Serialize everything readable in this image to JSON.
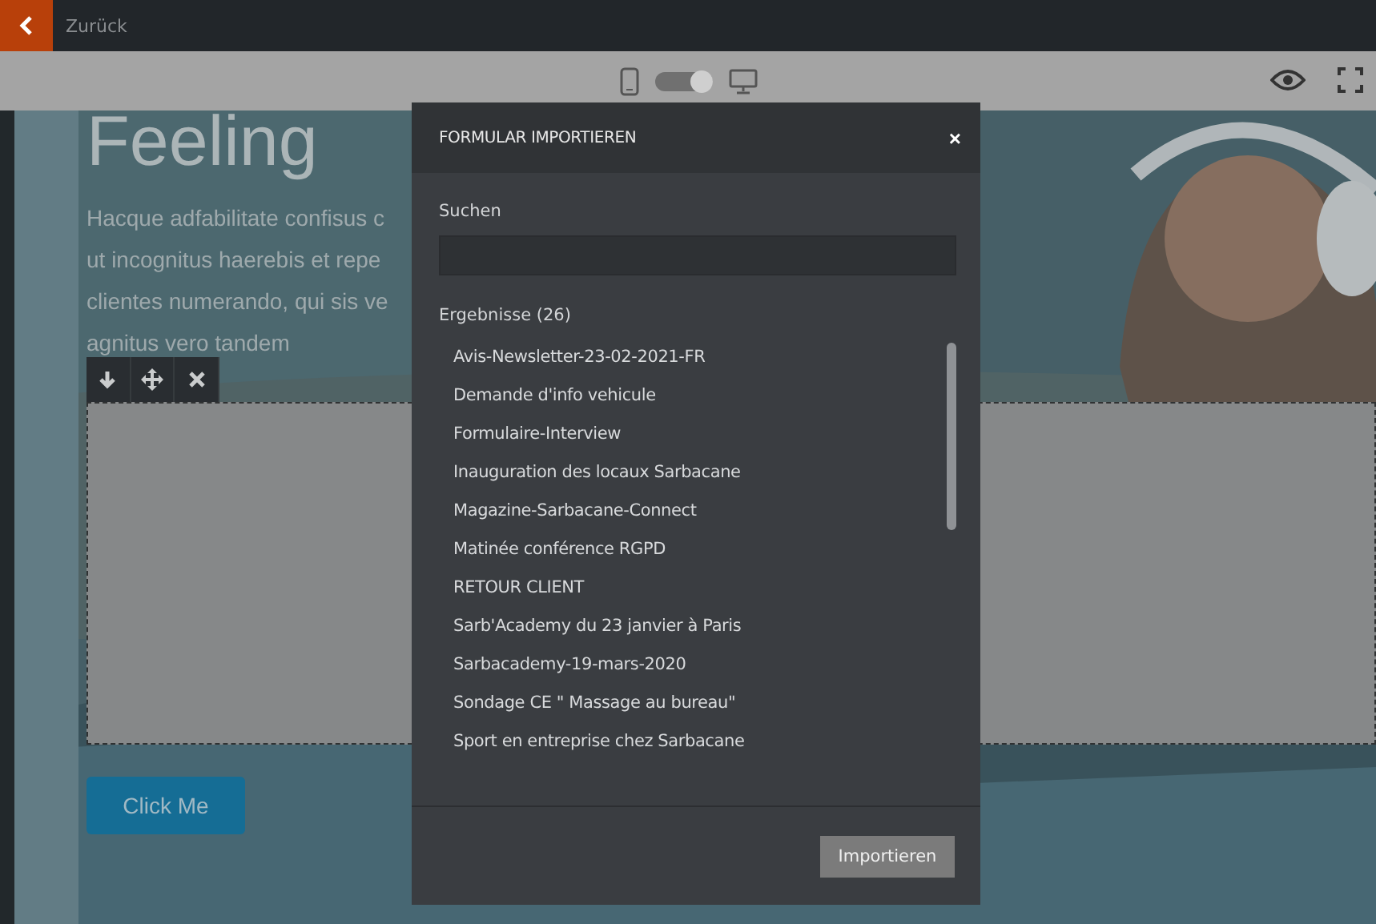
{
  "top_bar": {
    "back_label": "Zurück"
  },
  "toolbar": {
    "view_toggle": {
      "on": true
    }
  },
  "canvas": {
    "heading": "Feeling",
    "paragraph_lines": [
      "Hacque adfabilitate confisus c",
      "ut incognitus haerebis et repe",
      "clientes numerando, qui sis ve",
      "agnitus vero tandem"
    ],
    "block_tools": [
      {
        "kind": "down"
      },
      {
        "kind": "move"
      },
      {
        "kind": "delete"
      }
    ],
    "button": "Click Me"
  },
  "dialog": {
    "title": "FORMULAR IMPORTIEREN",
    "close": "×",
    "search_label": "Suchen",
    "results_label": "Ergebnisse (26)",
    "results": [
      {
        "label": "Avis-Newsletter-23-02-2021-FR",
        "selected": false
      },
      {
        "label": "Demande d'info vehicule",
        "selected": false
      },
      {
        "label": "Formulaire-Interview",
        "selected": false
      },
      {
        "label": "Inauguration des locaux Sarbacane",
        "selected": false
      },
      {
        "label": "Magazine-Sarbacane-Connect",
        "selected": false
      },
      {
        "label": "Matinée conférence RGPD",
        "selected": false
      },
      {
        "label": "RETOUR CLIENT",
        "selected": false
      },
      {
        "label": "Sarb'Academy du 23 janvier à Paris",
        "selected": false
      },
      {
        "label": "Sarbacademy-19-mars-2020",
        "selected": false
      },
      {
        "label": "Sondage CE \" Massage au bureau\"",
        "selected": false
      },
      {
        "label": "Sport en entreprise chez Sarbacane",
        "selected": false
      }
    ],
    "import_button": "Importieren"
  }
}
